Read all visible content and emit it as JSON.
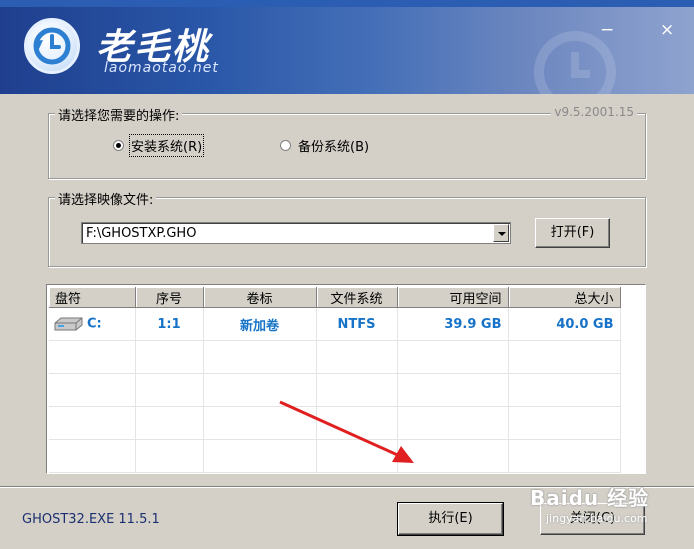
{
  "app": {
    "brand": "老毛桃",
    "domain": "laomaotao.net"
  },
  "operation_group": {
    "label": "请选择您需要的操作:",
    "version": "v9.5.2001.15",
    "options": [
      {
        "label": "安装系统(R)",
        "checked": true
      },
      {
        "label": "备份系统(B)",
        "checked": false
      }
    ]
  },
  "image_group": {
    "label": "请选择映像文件:",
    "selected_file": "F:\\GHOSTXP.GHO",
    "open_button": "打开(F)"
  },
  "table": {
    "columns": [
      "盘符",
      "序号",
      "卷标",
      "文件系统",
      "可用空间",
      "总大小"
    ],
    "rows": [
      {
        "drive": "C:",
        "index": "1:1",
        "label": "新加卷",
        "fs": "NTFS",
        "free": "39.9 GB",
        "total": "40.0 GB"
      }
    ]
  },
  "footer": {
    "ghost_version": "GHOST32.EXE 11.5.1",
    "execute_button": "执行(E)",
    "close_button": "关闭(C)"
  },
  "watermark": {
    "text": "Baidu 经验",
    "sub": "jingyan.baidu.com"
  },
  "colors": {
    "accent": "#1673c7",
    "title_gradient_start": "#1f3f8e",
    "annotation_arrow": "#e02020"
  }
}
